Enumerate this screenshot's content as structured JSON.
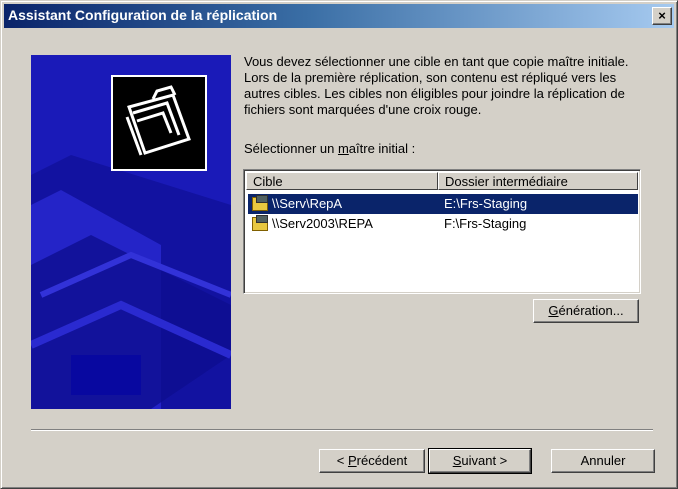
{
  "window": {
    "title": "Assistant Configuration de la réplication",
    "close_label": "×"
  },
  "content": {
    "description": "Vous devez sélectionner une cible en tant que copie maître initiale. Lors de la première réplication, son contenu est répliqué vers les autres cibles. Les cibles non éligibles pour joindre la réplication de fichiers sont marquées d'une croix rouge.",
    "select_label_before": "Sélectionner un ",
    "select_label_underlined": "m",
    "select_label_after": "aître initial :"
  },
  "list": {
    "columns": [
      "Cible",
      "Dossier intermédiaire"
    ],
    "rows": [
      {
        "name": "\\\\Serv\\RepA",
        "path": "E:\\Frs-Staging",
        "selected": true
      },
      {
        "name": "\\\\Serv2003\\REPA",
        "path": "F:\\Frs-Staging",
        "selected": false
      }
    ]
  },
  "buttons": {
    "generation_u": "G",
    "generation_rest": "énération...",
    "back_prefix": "< ",
    "back_u": "P",
    "back_rest": "récédent",
    "next_u": "S",
    "next_rest": "uivant >",
    "cancel": "Annuler"
  },
  "colors": {
    "titlebar_start": "#0a246a",
    "titlebar_end": "#a6caf0",
    "side_panel": "#1a1ab8",
    "selection": "#0a246a",
    "face": "#d4d0c8"
  },
  "icons": {
    "wizard_graphic": "folders-icon",
    "row_icon": "share-folder-icon"
  }
}
